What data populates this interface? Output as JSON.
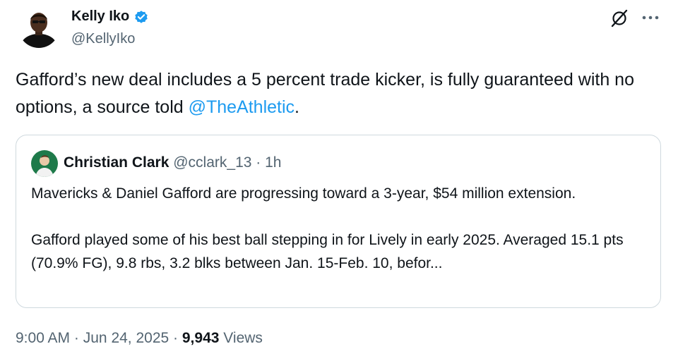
{
  "author": {
    "name": "Kelly Iko",
    "handle": "@KellyIko",
    "verified": true,
    "avatar_icon": "person-avatar-icon"
  },
  "actions": {
    "grok_icon": "grok-icon",
    "more_icon": "more-options-icon"
  },
  "tweet": {
    "text_before": "Gafford’s new deal includes a 5 percent trade kicker, is fully guaranteed with no options, a source told ",
    "mention": "@TheAthletic",
    "text_after": "."
  },
  "quote": {
    "name": "Christian Clark",
    "handle": "@cclark_13",
    "time": "1h",
    "separator": "·",
    "paragraph1": "Mavericks & Daniel Gafford are progressing toward a 3-year, $54 million extension.",
    "paragraph2": "Gafford played some of his best ball stepping in for Lively in early 2025. Averaged 15.1 pts (70.9% FG), 9.8 rbs, 3.2 blks between Jan. 15-Feb. 10, befor..."
  },
  "meta": {
    "time": "9:00 AM",
    "date": "Jun 24, 2025",
    "separator": "·",
    "views_count": "9,943",
    "views_label": "Views"
  },
  "colors": {
    "text": "#0f1419",
    "secondary": "#536471",
    "link": "#1d9bf0",
    "border": "#cfd9de",
    "verified": "#1d9bf0"
  }
}
